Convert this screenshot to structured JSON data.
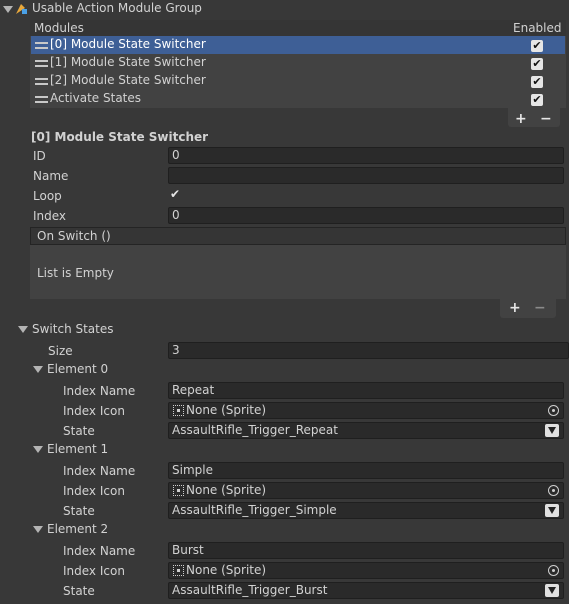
{
  "header": {
    "title": "Usable Action Module Group"
  },
  "modules_list": {
    "col_modules": "Modules",
    "col_enabled": "Enabled",
    "rows": [
      {
        "label": "[0] Module State Switcher",
        "enabled": true,
        "selected": true
      },
      {
        "label": "[1] Module State Switcher",
        "enabled": true,
        "selected": false
      },
      {
        "label": "[2] Module State Switcher",
        "enabled": true,
        "selected": false
      },
      {
        "label": "Activate States",
        "enabled": true,
        "selected": false
      }
    ],
    "add_label": "+",
    "remove_label": "−"
  },
  "selected_module": {
    "title": "[0] Module State Switcher",
    "id_label": "ID",
    "id_value": "0",
    "name_label": "Name",
    "name_value": "",
    "loop_label": "Loop",
    "loop_checked": true,
    "index_label": "Index",
    "index_value": "0"
  },
  "on_switch": {
    "header": "On Switch ()",
    "empty_text": "List is Empty",
    "add_label": "+",
    "remove_label": "−"
  },
  "switch_states": {
    "label": "Switch States",
    "size_label": "Size",
    "size_value": "3",
    "elements": [
      {
        "label": "Element 0",
        "index_name_label": "Index Name",
        "index_name": "Repeat",
        "index_icon_label": "Index Icon",
        "index_icon": "None (Sprite)",
        "state_label": "State",
        "state": "AssaultRifle_Trigger_Repeat"
      },
      {
        "label": "Element 1",
        "index_name_label": "Index Name",
        "index_name": "Simple",
        "index_icon_label": "Index Icon",
        "index_icon": "None (Sprite)",
        "state_label": "State",
        "state": "AssaultRifle_Trigger_Simple"
      },
      {
        "label": "Element 2",
        "index_name_label": "Index Name",
        "index_name": "Burst",
        "index_icon_label": "Index Icon",
        "index_icon": "None (Sprite)",
        "state_label": "State",
        "state": "AssaultRifle_Trigger_Burst"
      }
    ]
  },
  "colors": {
    "background": "#383838",
    "list_bg": "#424242",
    "selected_row": "#3e5f96",
    "field_bg": "#2a2a2a",
    "text": "#d2d2d2"
  },
  "icons": {
    "component": "script-component-icon",
    "foldout": "triangle-down-icon",
    "drag_handle": "drag-handle-icon",
    "object_picker": "object-picker-icon",
    "sprite": "sprite-icon",
    "dropdown": "dropdown-arrow-icon",
    "check": "checkmark-icon"
  }
}
